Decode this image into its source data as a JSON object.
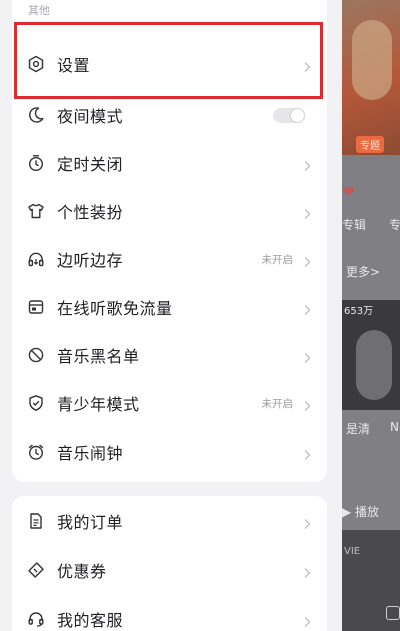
{
  "drawer": {
    "section_label": "其他",
    "top_items": [
      {
        "label": "设置",
        "status": ""
      },
      {
        "label": "夜间模式",
        "status": ""
      },
      {
        "label": "定时关闭",
        "status": ""
      },
      {
        "label": "个性装扮",
        "status": ""
      },
      {
        "label": "边听边存",
        "status": "未开启"
      },
      {
        "label": "在线听歌免流量",
        "status": ""
      },
      {
        "label": "音乐黑名单",
        "status": ""
      },
      {
        "label": "青少年模式",
        "status": "未开启"
      },
      {
        "label": "音乐闹钟",
        "status": ""
      }
    ],
    "bottom_items": [
      {
        "label": "我的订单"
      },
      {
        "label": "优惠券"
      },
      {
        "label": "我的客服"
      }
    ],
    "night_mode_toggle": false,
    "highlight_color": "#e02a31"
  },
  "background": {
    "tag": "专题",
    "album_label": "专辑",
    "truncated_label": "专",
    "more_label": "更多>",
    "count_label": "653万",
    "caption": "是清",
    "caption2": "N",
    "play_label": "▶ 播放",
    "vie_label": "VIE"
  }
}
